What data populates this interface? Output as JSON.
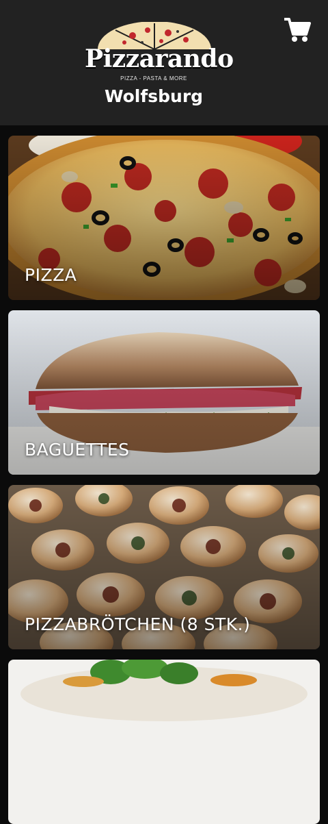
{
  "header": {
    "brand_name": "Pizzarando",
    "tagline": "PIZZA - PASTA & MORE",
    "city": "Wolfsburg",
    "cart_icon": "shopping-cart-icon",
    "background_color": "#222222"
  },
  "categories": [
    {
      "label": "PIZZA"
    },
    {
      "label": "BAGUETTES"
    },
    {
      "label": "PIZZABRÖTCHEN (8 STK.)"
    },
    {
      "label": ""
    }
  ]
}
